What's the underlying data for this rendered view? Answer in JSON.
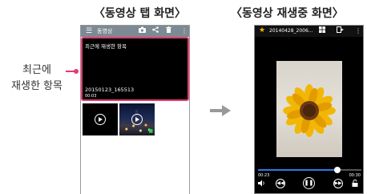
{
  "titles": {
    "left": "〈동영상 탭 화면〉",
    "right": "〈동영상 재생중 화면〉"
  },
  "callout": {
    "line1": "최근에",
    "line2": "재생한 항목",
    "color": "#e8386d"
  },
  "left_screen": {
    "top_bar": {
      "menu_icon": "hamburger-menu-icon",
      "label": "동영상",
      "icons": [
        "camera-icon",
        "share-icon",
        "trash-icon",
        "more-vert-icon"
      ]
    },
    "recent": {
      "heading": "최근에 재생한 항목",
      "file_name": "20150123_165513",
      "duration": "00:03"
    },
    "thumbnails": [
      {
        "name": "video-thumb-dark",
        "icon": "play-circle-icon"
      },
      {
        "name": "video-thumb-night-city",
        "icon": "play-circle-icon",
        "badge": "lock-icon"
      }
    ]
  },
  "right_screen": {
    "top_bar": {
      "star_icon": "star-icon",
      "file_name": "20140428_2006...",
      "icons": [
        "split-view-icon",
        "popup-play-icon",
        "more-vert-icon"
      ]
    },
    "playback": {
      "current_time": "00:23",
      "total_time": "00:30",
      "progress": 0.77,
      "accent": "#2b7be3"
    },
    "controls": [
      "volume-icon",
      "rewind-icon",
      "pause-icon",
      "fast-forward-icon",
      "lock-icon"
    ]
  }
}
